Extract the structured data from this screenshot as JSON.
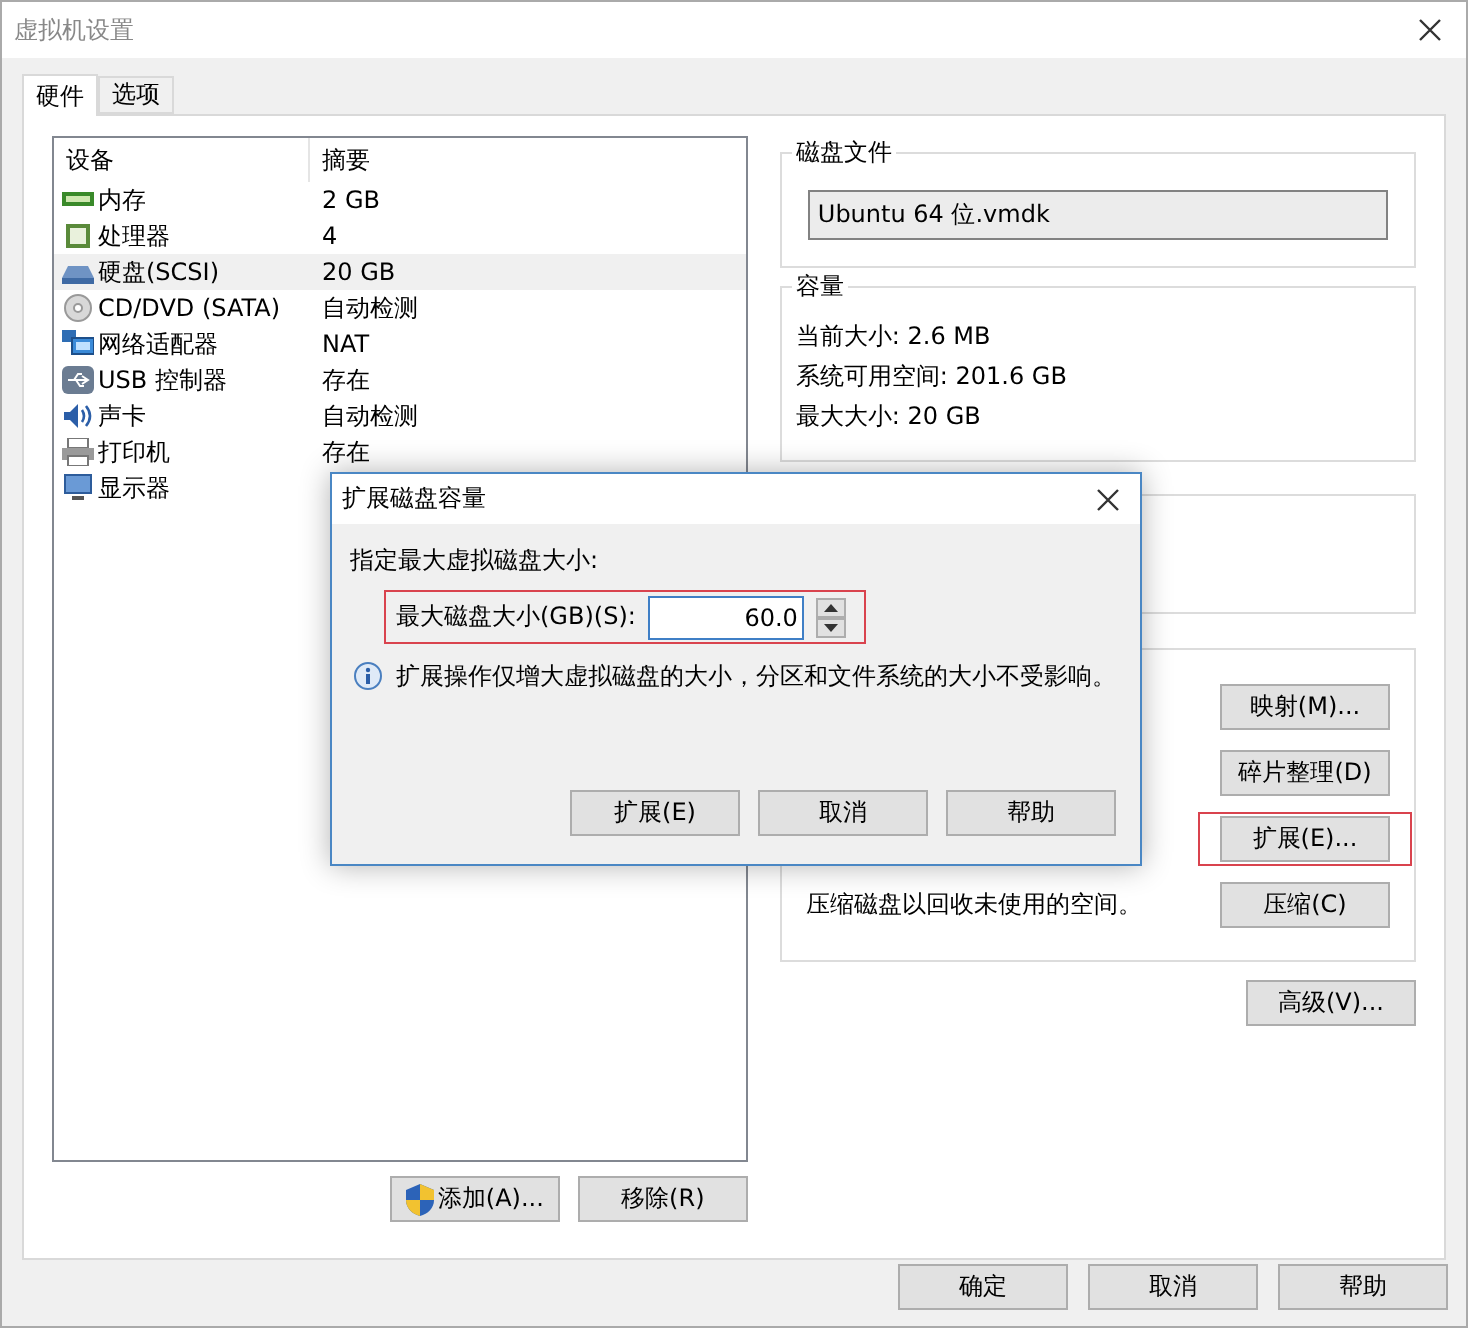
{
  "window": {
    "title": "虚拟机设置"
  },
  "tabs": [
    {
      "label": "硬件",
      "selected": true
    },
    {
      "label": "选项",
      "selected": false
    }
  ],
  "device_list": {
    "columns": [
      "设备",
      "摘要"
    ],
    "rows": [
      {
        "kind": "memory",
        "device": "内存",
        "summary": "2 GB",
        "selected": false
      },
      {
        "kind": "cpu",
        "device": "处理器",
        "summary": "4",
        "selected": false
      },
      {
        "kind": "disk",
        "device": "硬盘(SCSI)",
        "summary": "20 GB",
        "selected": true
      },
      {
        "kind": "cdrom",
        "device": "CD/DVD (SATA)",
        "summary": "自动检测",
        "selected": false
      },
      {
        "kind": "network",
        "device": "网络适配器",
        "summary": "NAT",
        "selected": false
      },
      {
        "kind": "usb",
        "device": "USB 控制器",
        "summary": "存在",
        "selected": false
      },
      {
        "kind": "sound",
        "device": "声卡",
        "summary": "自动检测",
        "selected": false
      },
      {
        "kind": "printer",
        "device": "打印机",
        "summary": "存在",
        "selected": false
      },
      {
        "kind": "display",
        "device": "显示器",
        "selected": false
      }
    ]
  },
  "list_buttons": [
    {
      "label": "添加(A)...",
      "shield": true
    },
    {
      "label": "移除(R)",
      "shield": false
    }
  ],
  "disk_file": {
    "title": "磁盘文件",
    "value": "Ubuntu 64 位.vmdk"
  },
  "capacity": {
    "title": "容量",
    "lines": [
      "当前大小: 2.6 MB",
      "系统可用空间: 201.6 GB",
      "最大大小: 20 GB"
    ]
  },
  "utilities": [
    {
      "label": "映射(M)...",
      "highlighted": false
    },
    {
      "label": "碎片整理(D)",
      "highlighted": false
    },
    {
      "label": "扩展(E)...",
      "highlighted": true
    },
    {
      "label": "压缩(C)",
      "highlighted": false,
      "note": "压缩磁盘以回收未使用的空间。"
    }
  ],
  "advanced_button": "高级(V)...",
  "footer_buttons": [
    "确定",
    "取消",
    "帮助"
  ],
  "dialog": {
    "title": "扩展磁盘容量",
    "prompt": "指定最大虚拟磁盘大小:",
    "field_label": "最大磁盘大小(GB)(S):",
    "value": "60.0",
    "highlighted": true,
    "info": "扩展操作仅增大虚拟磁盘的大小，分区和文件系统的大小不受影响。",
    "buttons": [
      "扩展(E)",
      "取消",
      "帮助"
    ]
  }
}
